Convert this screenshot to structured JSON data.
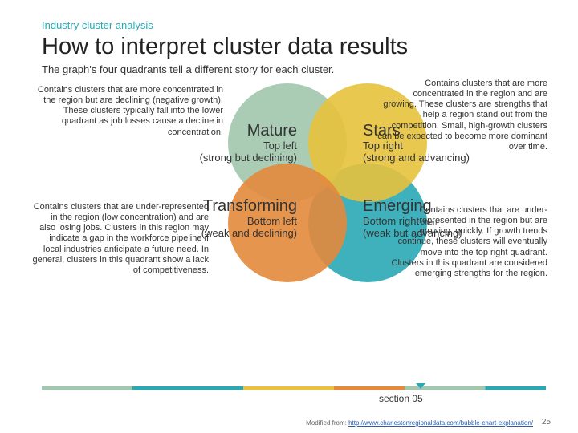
{
  "kicker": "Industry cluster analysis",
  "title": "How to interpret cluster data results",
  "subtitle": "The graph's four quadrants tell a different story for each cluster.",
  "q": {
    "tl": {
      "name": "Mature",
      "pos": "Top left",
      "note": "(strong but declining)"
    },
    "tr": {
      "name": "Stars",
      "pos": "Top right",
      "note": "(strong and advancing)"
    },
    "bl": {
      "name": "Transforming",
      "pos": "Bottom left",
      "note": "(weak and declining)"
    },
    "br": {
      "name": "Emerging",
      "pos": "Bottom right",
      "note": "(weak but advancing)",
      "often": "often"
    }
  },
  "desc": {
    "tl": "Contains clusters that are more concentrated in the region but are declining (negative growth). These clusters typically fall into the lower quadrant as job losses cause a decline in concentration.",
    "tr": "Contains clusters that are more concentrated in the region and are growing. These clusters are strengths that help a region stand out from the competition. Small, high-growth clusters can be expected to become more dominant over time.",
    "bl": "Contains clusters that are under-represented in the region (low concentration) and are also losing jobs. Clusters in this region may indicate a gap in the workforce pipeline if local industries anticipate a future need. In general, clusters in this quadrant show a lack of competitiveness.",
    "br": "Contains clusters that are under-represented in the region but are growing, quickly. If growth trends continue, these clusters will eventually move into the top right quadrant. Clusters in this quadrant are considered emerging strengths for the region."
  },
  "footer": {
    "section": "section 05",
    "credit_prefix": "Modified from: ",
    "credit_url": "http://www.charlestonregionaldata.com/bubble-chart-explanation/",
    "page": "25"
  }
}
